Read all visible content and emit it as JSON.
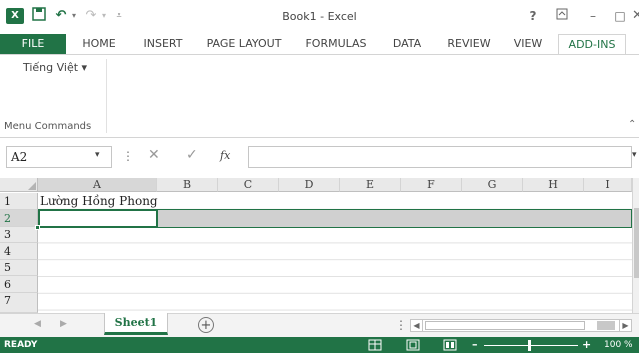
{
  "window": {
    "title": "Book1 - Excel"
  },
  "qat": {
    "app_icon": "X",
    "save_icon": "save-icon",
    "undo_icon": "undo-icon",
    "redo_icon": "redo-icon"
  },
  "controls": {
    "help": "?",
    "minimize": "–",
    "restore": "□"
  },
  "tabs": [
    {
      "label": "FILE"
    },
    {
      "label": "HOME"
    },
    {
      "label": "INSERT"
    },
    {
      "label": "PAGE LAYOUT"
    },
    {
      "label": "FORMULAS"
    },
    {
      "label": "DATA"
    },
    {
      "label": "REVIEW"
    },
    {
      "label": "VIEW"
    },
    {
      "label": "ADD-INS"
    }
  ],
  "ribbon": {
    "dropdown_label": "Tiếng Việt ▾",
    "group_label": "Menu Commands"
  },
  "formula_bar": {
    "name_box": "A2",
    "fx": "fx",
    "value": ""
  },
  "grid": {
    "columns": [
      "A",
      "B",
      "C",
      "D",
      "E",
      "F",
      "G",
      "H",
      "I"
    ],
    "rows": [
      "1",
      "2",
      "3",
      "4",
      "5",
      "6",
      "7"
    ],
    "cells": {
      "A1": "Lường Hồng Phong"
    }
  },
  "sheets": {
    "active": "Sheet1",
    "add": "+"
  },
  "status": {
    "mode": "READY",
    "zoom": "100 %"
  },
  "colors": {
    "accent": "#217346",
    "header_bg": "#e9e9e9",
    "selection_row": "#d0d0d0"
  }
}
